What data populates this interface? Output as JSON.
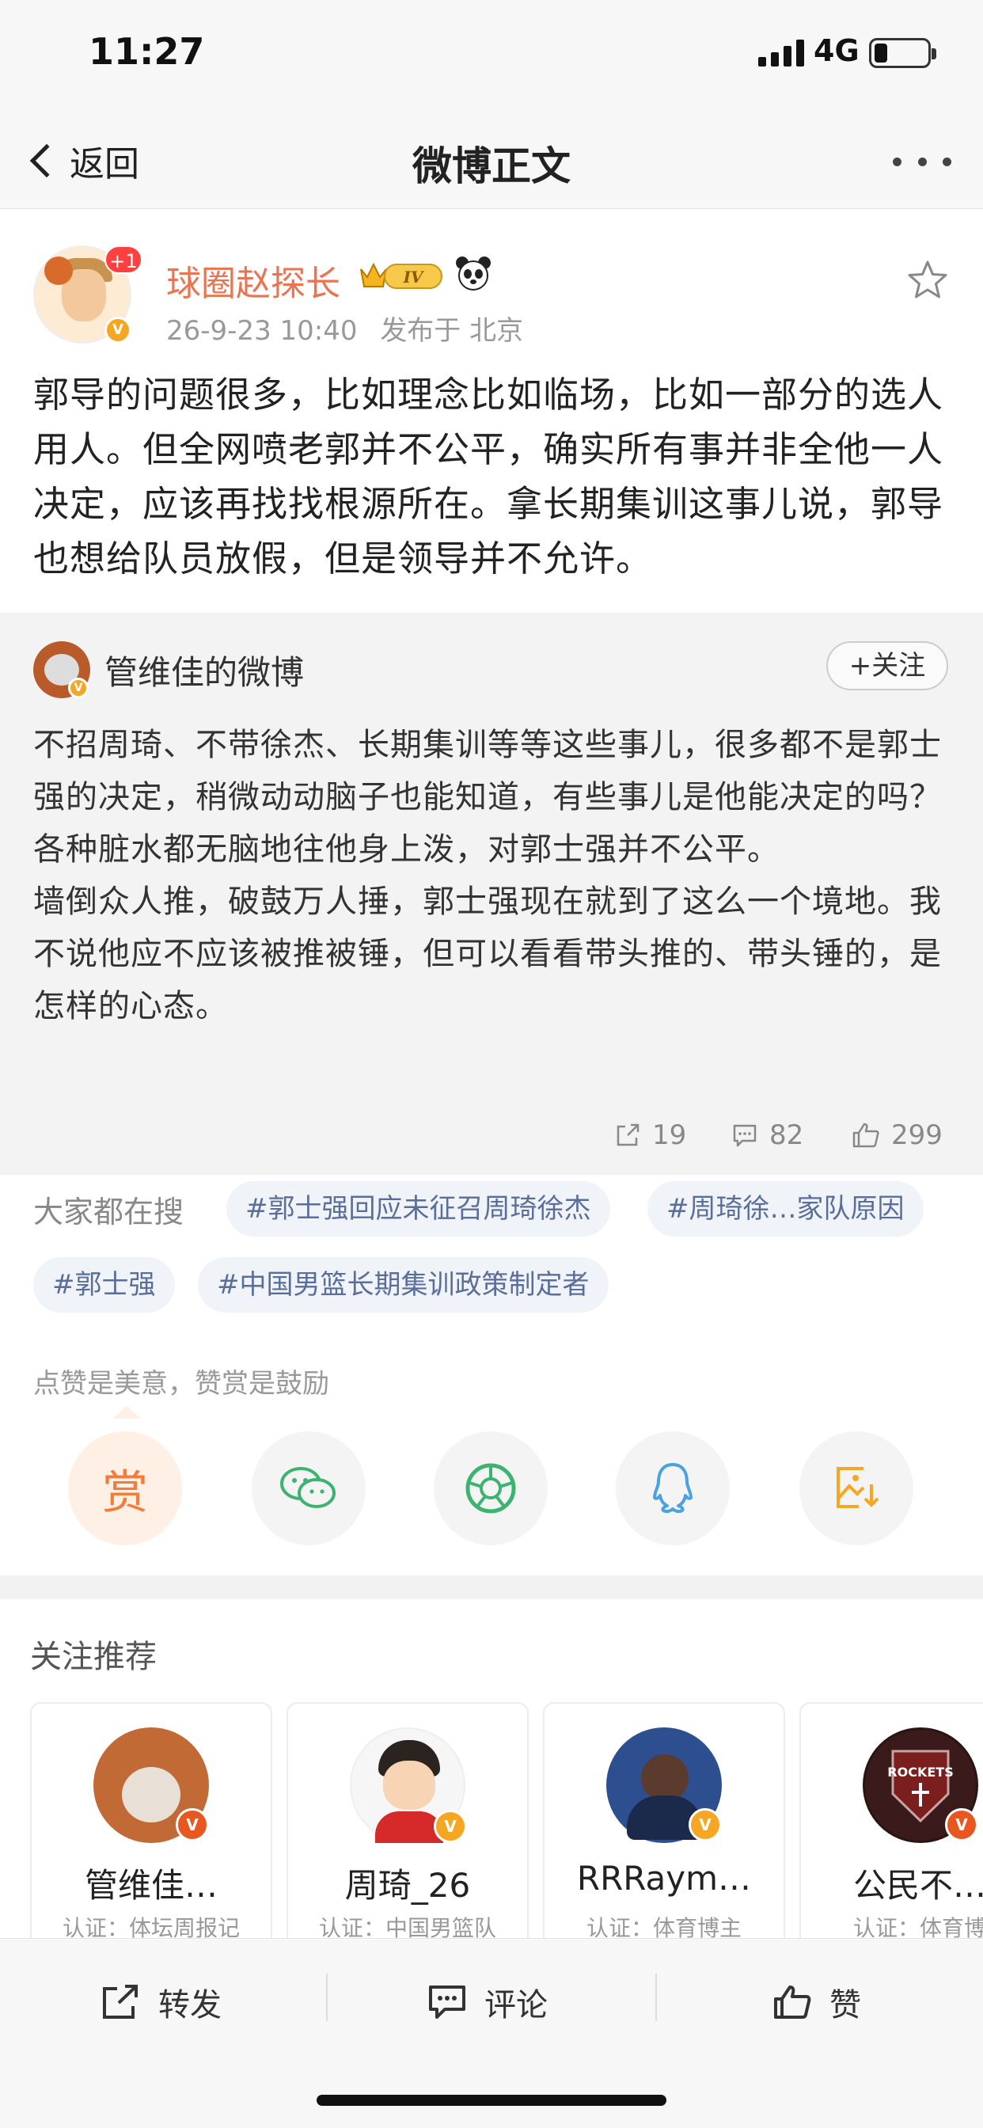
{
  "status_bar": {
    "time": "11:27",
    "network": "4G",
    "battery_level": 0.25
  },
  "nav": {
    "back_label": "返回",
    "title": "微博正文"
  },
  "post": {
    "author_name": "球圈赵探长",
    "notification_badge": "+1",
    "level_badge": "IV",
    "timestamp": "26-9-23 10:40",
    "location": "发布于 北京",
    "text": "郭导的问题很多，比如理念比如临场，比如一部分的选人用人。但全网喷老郭并不公平，确实所有事并非全他一人决定，应该再找找根源所在。拿长期集训这事儿说，郭导也想给队员放假，但是领导并不允许。"
  },
  "repost": {
    "author_name": "管维佳的微博",
    "follow_label": "+关注",
    "paragraph_1": "不招周琦、不带徐杰、长期集训等等这些事儿，很多都不是郭士强的决定，稍微动动脑子也能知道，有些事儿是他能决定的吗？各种脏水都无脑地往他身上泼，对郭士强并不公平。",
    "paragraph_2": "墙倒众人推，破鼓万人捶，郭士强现在就到了这么一个境地。我不说他应不应该被推被锤，但可以看看带头推的、带头锤的，是怎样的心态。",
    "repost_count": "19",
    "comment_count": "82",
    "like_count": "299"
  },
  "trending": {
    "label": "大家都在搜",
    "tags": [
      "#郭士强回应未征召周琦徐杰",
      "#周琦徐…家队原因",
      "#郭士强",
      "#中国男篮长期集训政策制定者"
    ]
  },
  "reward": {
    "hint": "点赞是美意，赞赏是鼓励",
    "reward_label": "赏"
  },
  "recommend": {
    "title": "关注推荐",
    "cards": [
      {
        "name": "管维佳…",
        "desc": "认证：体坛周报记"
      },
      {
        "name": "周琦_26",
        "desc": "认证：中国男篮队"
      },
      {
        "name": "RRRaym…",
        "desc": "认证：体育博主"
      },
      {
        "name": "公民不…",
        "desc": "认证：体育博"
      }
    ],
    "card_4_logo_text": "ROCKETS"
  },
  "bottom_bar": {
    "repost_label": "转发",
    "comment_label": "评论",
    "like_label": "赞"
  },
  "colors": {
    "author_orange": "#eb7350",
    "tag_blue": "#5a6e9c",
    "reward_orange": "#f47b3a",
    "wechat_green": "#3cb371",
    "qq_blue": "#4aa3df"
  }
}
